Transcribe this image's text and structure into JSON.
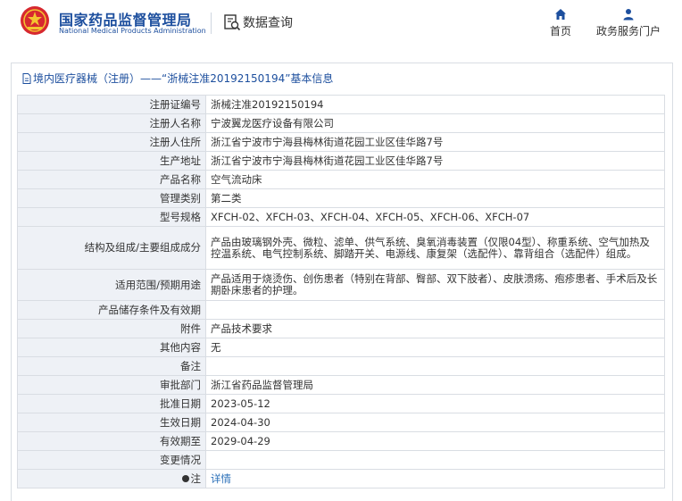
{
  "header": {
    "site_name_cn": "国家药品监督管理局",
    "site_name_en": "National Medical Products Administration",
    "data_query": "数据查询",
    "nav_home": "首页",
    "nav_portal": "政务服务门户"
  },
  "breadcrumb": {
    "category": "境内医疗器械（注册）",
    "separator": "——",
    "title": "“浙械注准20192150194”基本信息"
  },
  "info": {
    "rows": [
      {
        "label": "注册证编号",
        "value": "浙械注准20192150194"
      },
      {
        "label": "注册人名称",
        "value": "宁波翼龙医疗设备有限公司"
      },
      {
        "label": "注册人住所",
        "value": "浙江省宁波市宁海县梅林街道花园工业区佳华路7号"
      },
      {
        "label": "生产地址",
        "value": "浙江省宁波市宁海县梅林街道花园工业区佳华路7号"
      },
      {
        "label": "产品名称",
        "value": "空气流动床"
      },
      {
        "label": "管理类别",
        "value": "第二类"
      },
      {
        "label": "型号规格",
        "value": "XFCH-02、XFCH-03、XFCH-04、XFCH-05、XFCH-06、XFCH-07"
      },
      {
        "label": "结构及组成/主要组成成分",
        "value": "产品由玻璃钢外壳、微粒、滤单、供气系统、臭氧消毒装置（仅限04型）、称重系统、空气加热及控温系统、电气控制系统、脚踏开关、电源线、康复架（选配件）、靠背组合（选配件）组成。"
      },
      {
        "label": "适用范围/预期用途",
        "value": "产品适用于烧烫伤、创伤患者（特别在背部、臀部、双下肢者）、皮肤溃疡、疱疹患者、手术后及长期卧床患者的护理。"
      },
      {
        "label": "产品储存条件及有效期",
        "value": ""
      },
      {
        "label": "附件",
        "value": "产品技术要求"
      },
      {
        "label": "其他内容",
        "value": "无"
      },
      {
        "label": "备注",
        "value": ""
      },
      {
        "label": "审批部门",
        "value": "浙江省药品监督管理局"
      },
      {
        "label": "批准日期",
        "value": "2023-05-12"
      },
      {
        "label": "生效日期",
        "value": "2024-04-30"
      },
      {
        "label": "有效期至",
        "value": "2029-04-29"
      },
      {
        "label": "变更情况",
        "value": ""
      },
      {
        "label": "注",
        "value": "详情"
      }
    ]
  },
  "colors": {
    "brand_blue": "#1d4f9e",
    "label_bg": "#eef1f6",
    "border": "#d9dde3",
    "link": "#2a6fb8"
  },
  "icons": {
    "emblem": "national-emblem-icon",
    "data_query": "document-search-icon",
    "home": "home-icon",
    "portal": "user-icon",
    "breadcrumb": "document-icon",
    "note": "dot-icon"
  }
}
